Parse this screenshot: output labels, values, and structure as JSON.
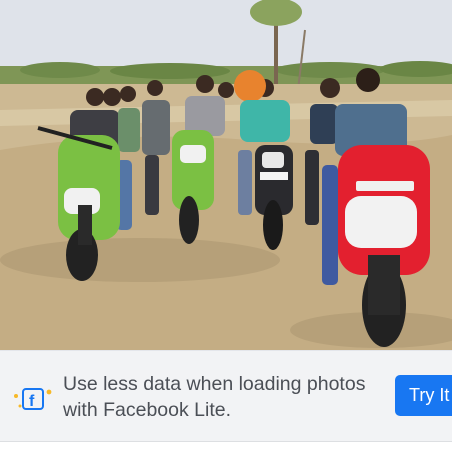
{
  "photo": {
    "alt_subject": "group-of-young-men-on-scooters-and-motorcycles",
    "colors": {
      "sky": "#dfe3ea",
      "ground": "#c9b48c",
      "green_scooter": "#7bc043",
      "red_scooter": "#e3202f",
      "treeline": "#6f8a4a"
    }
  },
  "banner": {
    "icon": "facebook-lite-icon",
    "message": "Use less data when loading photos with Facebook Lite.",
    "button_label": "Try It",
    "colors": {
      "background": "#f2f3f5",
      "text": "#4b4f56",
      "button": "#1877f2"
    }
  }
}
